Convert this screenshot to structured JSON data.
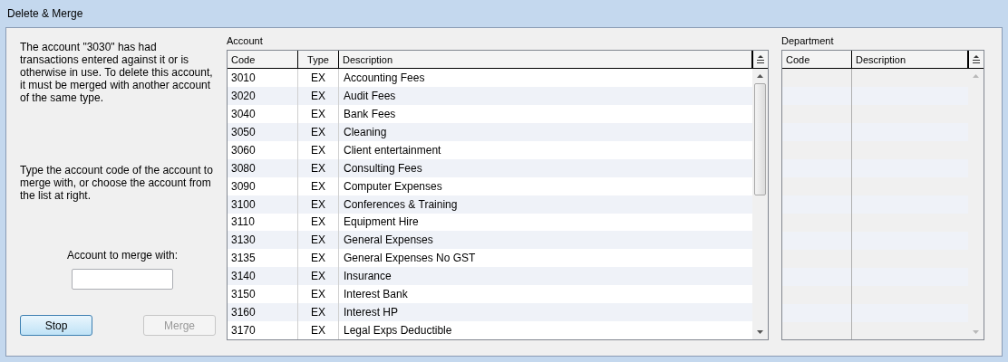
{
  "window": {
    "title": "Delete & Merge"
  },
  "message": "The account \"3030\" has had transactions entered against it or is otherwise in use. To delete this account, it must be merged with another account of the same type.",
  "instruction": "Type the account code of the account to merge with, or choose the account from the list at right.",
  "merge_field": {
    "label": "Account to merge with:"
  },
  "buttons": [
    {
      "label": "Stop",
      "disabled": false,
      "focused": true
    },
    {
      "label": "Merge",
      "disabled": true,
      "focused": false
    }
  ],
  "account_table": {
    "title": "Account",
    "columns": [
      "Code",
      "Type",
      "Description"
    ],
    "rows": [
      {
        "code": "3010",
        "type": "EX",
        "description": "Accounting Fees"
      },
      {
        "code": "3020",
        "type": "EX",
        "description": "Audit Fees"
      },
      {
        "code": "3040",
        "type": "EX",
        "description": "Bank Fees"
      },
      {
        "code": "3050",
        "type": "EX",
        "description": "Cleaning"
      },
      {
        "code": "3060",
        "type": "EX",
        "description": "Client entertainment"
      },
      {
        "code": "3080",
        "type": "EX",
        "description": "Consulting Fees"
      },
      {
        "code": "3090",
        "type": "EX",
        "description": "Computer Expenses"
      },
      {
        "code": "3100",
        "type": "EX",
        "description": "Conferences & Training"
      },
      {
        "code": "3110",
        "type": "EX",
        "description": "Equipment Hire"
      },
      {
        "code": "3130",
        "type": "EX",
        "description": "General Expenses"
      },
      {
        "code": "3135",
        "type": "EX",
        "description": "General Expenses No GST"
      },
      {
        "code": "3140",
        "type": "EX",
        "description": "Insurance"
      },
      {
        "code": "3150",
        "type": "EX",
        "description": "Interest Bank"
      },
      {
        "code": "3160",
        "type": "EX",
        "description": "Interest HP"
      },
      {
        "code": "3170",
        "type": "EX",
        "description": "Legal Exps Deductible"
      }
    ]
  },
  "department_table": {
    "title": "Department",
    "columns": [
      "Code",
      "Description"
    ]
  }
}
